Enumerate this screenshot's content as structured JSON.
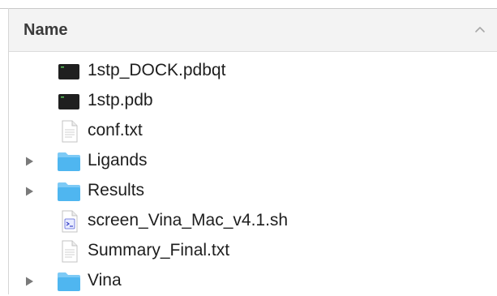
{
  "header": {
    "name_label": "Name",
    "sort_icon": "chevron-up-icon"
  },
  "files": [
    {
      "name": "1stp_DOCK.pdbqt",
      "kind": "terminal",
      "expandable": false
    },
    {
      "name": "1stp.pdb",
      "kind": "terminal",
      "expandable": false
    },
    {
      "name": "conf.txt",
      "kind": "text",
      "expandable": false
    },
    {
      "name": "Ligands",
      "kind": "folder",
      "expandable": true
    },
    {
      "name": "Results",
      "kind": "folder",
      "expandable": true
    },
    {
      "name": "screen_Vina_Mac_v4.1.sh",
      "kind": "script",
      "expandable": false
    },
    {
      "name": "Summary_Final.txt",
      "kind": "text",
      "expandable": false
    },
    {
      "name": "Vina",
      "kind": "folder",
      "expandable": true
    }
  ],
  "colors": {
    "folder": "#4fb6f0",
    "folder_tab": "#7dcaf6",
    "header_bg": "#f3f3f3"
  }
}
